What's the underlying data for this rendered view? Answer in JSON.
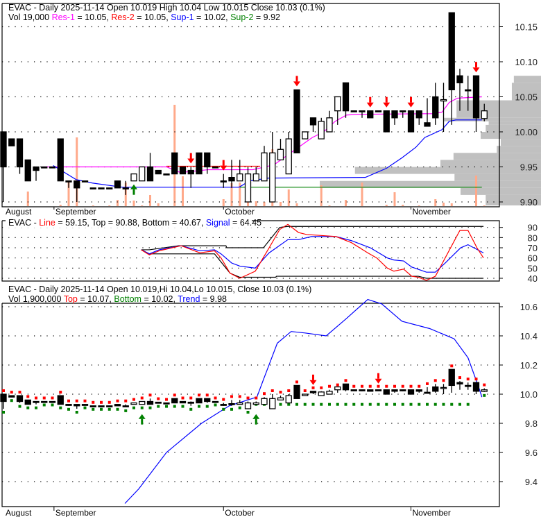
{
  "ticker": "EVAC",
  "main": {
    "header": {
      "line1": "EVAC - Daily 2025-11-14 Open 10.019  High 10.04  Low 10.015  Close 10.03 (0.1%)",
      "vol": "Vol 19,000 ",
      "res1_label": "Res-1",
      "res1_value": " = 10.05, ",
      "res2_label": "Res-2",
      "res2_value": " = 10.05, ",
      "sup1_label": "Sup-1",
      "sup1_value": " = 10.02, ",
      "sup2_label": "Sup-2",
      "sup2_value": " = 9.92"
    },
    "y_ticks": [
      "10.15",
      "10.10",
      "10.05",
      "10.00",
      "9.95",
      "9.90"
    ],
    "y_tick_values": [
      10.15,
      10.1,
      10.05,
      10.0,
      9.95,
      9.9
    ]
  },
  "stoch": {
    "header": {
      "prefix": "EVAC - ",
      "line_label": "Line",
      "mid": " = 59.15, Top = 90.88, Bottom = 40.67, ",
      "signal_label": "Signal",
      "signal_value": " = 64.45"
    },
    "y_ticks": [
      "90",
      "80",
      "70",
      "60",
      "50",
      "40"
    ],
    "y_tick_values": [
      90,
      80,
      70,
      60,
      50,
      40
    ]
  },
  "trend": {
    "header": {
      "line1": "EVAC - Daily 2025-11-14 Open 10.019,Hi 10.04,Lo 10.015, Close 10.03 (0.1%)",
      "vol": "Vol 1,900,000 ",
      "top_label": "Top",
      "top_value": " = 10.07, ",
      "bottom_label": "Bottom",
      "bottom_value": " = 10.02, ",
      "trend_label": "Trend",
      "trend_value": " = 9.98"
    },
    "y_ticks": [
      "10.6",
      "10.4",
      "10.2",
      "10.0",
      "9.8",
      "9.6",
      "9.4"
    ],
    "y_tick_values": [
      10.6,
      10.4,
      10.2,
      10.0,
      9.8,
      9.6,
      9.4
    ]
  },
  "months": [
    {
      "label": "August",
      "bar": 0
    },
    {
      "label": "September",
      "bar": 6.2
    },
    {
      "label": "October",
      "bar": 27
    },
    {
      "label": "November",
      "bar": 50
    }
  ],
  "colors": {
    "res1": "#ff00ff",
    "res2": "#ff0000",
    "sup1": "#0000ff",
    "sup2": "#008000",
    "volume": "#ffa98a",
    "profile": "#c0c0c0",
    "up_arrow": "#008000",
    "down_arrow": "#ff0000"
  },
  "chart_data": [
    {
      "type": "candlestick",
      "title": "EVAC - Daily",
      "ylim": [
        9.895,
        10.185
      ],
      "ohlc": [
        [
          10.0,
          10.0,
          9.9,
          9.95
        ],
        [
          9.99,
          9.99,
          9.98,
          9.98
        ],
        [
          9.99,
          9.99,
          9.94,
          9.95
        ],
        [
          9.96,
          9.96,
          9.93,
          9.93
        ],
        [
          9.95,
          9.95,
          9.93,
          9.945
        ],
        [
          9.95,
          9.95,
          9.95,
          9.95
        ],
        [
          9.95,
          9.95,
          9.95,
          9.95
        ],
        [
          9.99,
          9.99,
          9.93,
          9.93
        ],
        [
          9.93,
          9.93,
          9.92,
          9.93
        ],
        [
          9.93,
          9.93,
          9.9,
          9.92
        ],
        [
          9.93,
          9.93,
          9.93,
          9.93
        ],
        [
          9.92,
          9.92,
          9.92,
          9.92
        ],
        [
          9.92,
          9.92,
          9.92,
          9.92
        ],
        [
          9.92,
          9.92,
          9.92,
          9.92
        ],
        [
          9.93,
          9.93,
          9.92,
          9.92
        ],
        [
          9.92,
          9.93,
          9.91,
          9.92
        ],
        [
          9.93,
          9.94,
          9.93,
          9.94
        ],
        [
          9.93,
          9.95,
          9.93,
          9.95
        ],
        [
          9.95,
          9.97,
          9.93,
          9.93
        ],
        [
          9.945,
          9.945,
          9.94,
          9.94
        ],
        [
          9.94,
          9.94,
          9.94,
          9.94
        ],
        [
          9.97,
          9.97,
          9.94,
          9.94
        ],
        [
          9.95,
          9.95,
          9.94,
          9.94
        ],
        [
          9.945,
          9.95,
          9.92,
          9.94
        ],
        [
          9.97,
          9.97,
          9.94,
          9.94
        ],
        [
          9.97,
          9.97,
          9.94,
          9.95
        ],
        [
          9.95,
          9.95,
          9.95,
          9.95
        ],
        [
          9.93,
          9.94,
          9.92,
          9.93
        ],
        [
          9.935,
          9.96,
          9.92,
          9.93
        ],
        [
          9.93,
          9.96,
          9.93,
          9.94
        ],
        [
          9.9,
          9.95,
          9.9,
          9.94
        ],
        [
          9.93,
          9.95,
          9.93,
          9.94
        ],
        [
          9.93,
          9.98,
          9.93,
          9.97
        ],
        [
          9.9,
          10.0,
          9.9,
          9.97
        ],
        [
          9.96,
          9.99,
          9.96,
          9.975
        ],
        [
          9.94,
          10.0,
          9.94,
          9.99
        ],
        [
          10.06,
          10.06,
          9.97,
          9.97
        ],
        [
          9.99,
          10.0,
          9.99,
          10.0
        ],
        [
          10.02,
          10.02,
          10.0,
          10.01
        ],
        [
          9.99,
          10.02,
          9.99,
          10.015
        ],
        [
          10.0,
          10.03,
          10.0,
          10.02
        ],
        [
          10.03,
          10.04,
          10.01,
          10.05
        ],
        [
          10.07,
          10.07,
          10.02,
          10.03
        ],
        [
          10.03,
          10.03,
          10.03,
          10.03
        ],
        [
          10.03,
          10.03,
          10.02,
          10.03
        ],
        [
          10.03,
          10.03,
          10.02,
          10.02
        ],
        [
          10.03,
          10.03,
          10.03,
          10.03
        ],
        [
          10.03,
          10.03,
          10.0,
          10.0
        ],
        [
          10.03,
          10.03,
          10.01,
          10.02
        ],
        [
          10.03,
          10.03,
          10.02,
          10.03
        ],
        [
          10.03,
          10.03,
          10.0,
          10.0
        ],
        [
          10.03,
          10.03,
          10.01,
          10.02
        ],
        [
          10.013,
          10.048,
          10.008,
          10.008
        ],
        [
          10.05,
          10.07,
          10.01,
          10.02
        ],
        [
          10.044,
          10.07,
          10.0,
          10.046
        ],
        [
          10.17,
          10.17,
          10.01,
          10.06
        ],
        [
          10.08,
          10.09,
          10.03,
          10.07
        ],
        [
          10.06,
          10.08,
          10.03,
          10.06
        ],
        [
          10.08,
          10.08,
          10.0,
          10.02
        ],
        [
          10.019,
          10.04,
          10.015,
          10.03
        ]
      ],
      "volume_relative": [
        0,
        0,
        0,
        21,
        0,
        0,
        0,
        2,
        37,
        99,
        0,
        1,
        0,
        1,
        9,
        34,
        8,
        1,
        16,
        4,
        0,
        146,
        43,
        0,
        0,
        0,
        0,
        10,
        33,
        34,
        10,
        7,
        6,
        82,
        6,
        24,
        4,
        0,
        0,
        30,
        1,
        0,
        9,
        0,
        34,
        0,
        0,
        2,
        20,
        2,
        0,
        1,
        0,
        10,
        5,
        4,
        0,
        0,
        44,
        1
      ],
      "res1_line": [
        [
          4.9,
          9.95
        ],
        [
          20,
          9.95
        ],
        [
          21.7,
          9.942
        ],
        [
          25.1,
          9.946
        ],
        [
          30.6,
          9.946
        ],
        [
          33.2,
          9.953
        ],
        [
          36.2,
          9.978
        ],
        [
          37.9,
          9.992
        ],
        [
          39.3,
          10.0
        ],
        [
          40.7,
          10.015
        ],
        [
          42.1,
          10.024
        ],
        [
          43.6,
          10.025
        ],
        [
          52.8,
          10.026
        ],
        [
          53.8,
          10.028
        ],
        [
          54.7,
          10.042
        ],
        [
          55.7,
          10.048
        ],
        [
          58.7,
          10.05
        ]
      ],
      "sup1_line": [
        [
          6.1,
          9.952
        ],
        [
          8.9,
          9.932
        ],
        [
          10.9,
          9.927
        ],
        [
          14.6,
          9.921
        ],
        [
          28.9,
          9.921
        ],
        [
          30.2,
          9.93
        ],
        [
          32.5,
          9.934
        ],
        [
          44.4,
          9.935
        ],
        [
          47,
          9.948
        ],
        [
          48.9,
          9.963
        ],
        [
          50.6,
          9.978
        ],
        [
          51.7,
          9.992
        ],
        [
          53.8,
          10.003
        ],
        [
          54.7,
          10.015
        ],
        [
          55.5,
          10.017
        ],
        [
          58.7,
          10.017
        ]
      ],
      "res2_line": [
        [
          20,
          9.951
        ],
        [
          31.5,
          9.951
        ]
      ],
      "sup2_line": [
        [
          29,
          9.921
        ],
        [
          58.7,
          9.921
        ]
      ],
      "sell_arrows": [
        23,
        27,
        36,
        45,
        47,
        50,
        58
      ],
      "buy_arrows": [
        16
      ],
      "volume_profile": [
        [
          10.07,
          10.08,
          0.27
        ],
        [
          10.045,
          10.07,
          0.29
        ],
        [
          10.02,
          10.045,
          0.84
        ],
        [
          10.015,
          10.02,
          0.97
        ],
        [
          10.01,
          10.015,
          0.52
        ],
        [
          10.0,
          10.01,
          0.55
        ],
        [
          9.99,
          10.0,
          0.6
        ],
        [
          9.98,
          9.99,
          0.4
        ],
        [
          9.97,
          9.98,
          0.44
        ],
        [
          9.96,
          9.97,
          0.87
        ],
        [
          9.95,
          9.96,
          1.0
        ],
        [
          9.94,
          9.95,
          1.85
        ],
        [
          9.93,
          9.94,
          0.86
        ],
        [
          9.92,
          9.93,
          2.2
        ],
        [
          9.91,
          9.92,
          0.8
        ],
        [
          9.895,
          9.91,
          0.55
        ]
      ]
    },
    {
      "type": "line",
      "title": "Stochastic",
      "ylim": [
        38,
        93
      ],
      "series": [
        {
          "name": "Line",
          "points": [
            [
              16.9,
              68
            ],
            [
              17.9,
              63
            ],
            [
              19.1,
              67
            ],
            [
              21.8,
              72
            ],
            [
              24.1,
              65
            ],
            [
              25.9,
              67
            ],
            [
              26.7,
              60
            ],
            [
              27.8,
              45
            ],
            [
              29.0,
              40
            ],
            [
              30.9,
              47
            ],
            [
              32.6,
              70
            ],
            [
              33.9,
              88
            ],
            [
              34.9,
              93
            ],
            [
              36.2,
              85
            ],
            [
              37.2,
              83
            ],
            [
              39.1,
              82
            ],
            [
              40.8,
              81
            ],
            [
              42.7,
              75
            ],
            [
              44.7,
              65
            ],
            [
              45.8,
              60
            ],
            [
              47.1,
              50
            ],
            [
              47.9,
              47
            ],
            [
              49.1,
              49
            ],
            [
              50.1,
              42
            ],
            [
              50.9,
              41
            ],
            [
              51.9,
              38
            ],
            [
              53.0,
              42
            ],
            [
              54.2,
              60
            ],
            [
              56.0,
              87
            ],
            [
              57.0,
              87
            ],
            [
              58.1,
              70
            ],
            [
              58.9,
              60
            ]
          ]
        },
        {
          "name": "Signal",
          "points": [
            [
              16.9,
              68
            ],
            [
              17.9,
              64
            ],
            [
              19.1,
              68
            ],
            [
              21.8,
              72
            ],
            [
              24.1,
              67
            ],
            [
              25.9,
              68
            ],
            [
              26.7,
              64
            ],
            [
              28.0,
              55
            ],
            [
              29.0,
              52
            ],
            [
              30.9,
              50
            ],
            [
              32.6,
              65
            ],
            [
              34.9,
              78
            ],
            [
              36.2,
              78
            ],
            [
              37.8,
              81
            ],
            [
              40.8,
              81
            ],
            [
              42.7,
              77
            ],
            [
              45.0,
              70
            ],
            [
              47.1,
              60
            ],
            [
              47.9,
              58
            ],
            [
              49.1,
              57
            ],
            [
              50.1,
              51
            ],
            [
              51.9,
              46
            ],
            [
              53.0,
              46
            ],
            [
              54.2,
              55
            ],
            [
              56.1,
              70
            ],
            [
              57.0,
              73
            ],
            [
              58.9,
              65
            ]
          ]
        },
        {
          "name": "Top",
          "points": [
            [
              16.9,
              68
            ],
            [
              17.9,
              68
            ],
            [
              21.5,
              72
            ],
            [
              27.3,
              72
            ],
            [
              27.4,
              70
            ],
            [
              31.9,
              70
            ],
            [
              33.9,
              90
            ],
            [
              34.9,
              91
            ],
            [
              58.9,
              91
            ]
          ]
        },
        {
          "name": "Bottom",
          "points": [
            [
              16.9,
              68
            ],
            [
              17.9,
              64
            ],
            [
              25.9,
              64
            ],
            [
              27.8,
              45
            ],
            [
              29.0,
              41
            ],
            [
              33.4,
              41
            ],
            [
              33.5,
              42
            ],
            [
              50.9,
              42
            ],
            [
              51.9,
              40
            ],
            [
              58.9,
              40
            ]
          ]
        }
      ]
    },
    {
      "type": "candlestick",
      "title": "Trend",
      "ylim": [
        9.2,
        10.75
      ],
      "trend_line": [
        [
          14.9,
          9.25
        ],
        [
          16.6,
          9.35
        ],
        [
          20,
          9.6
        ],
        [
          24.3,
          9.8
        ],
        [
          27.7,
          9.92
        ],
        [
          31.1,
          9.98
        ],
        [
          31.9,
          10.1
        ],
        [
          33.6,
          10.35
        ],
        [
          35.3,
          10.43
        ],
        [
          37,
          10.42
        ],
        [
          39.6,
          10.4
        ],
        [
          42.1,
          10.52
        ],
        [
          44.7,
          10.65
        ],
        [
          46.4,
          10.62
        ],
        [
          48.9,
          10.5
        ],
        [
          52.3,
          10.45
        ],
        [
          55.3,
          10.38
        ],
        [
          57,
          10.25
        ],
        [
          58.3,
          10.05
        ],
        [
          58.7,
          9.98
        ]
      ],
      "bottom_line": {
        "value": 9.93,
        "from_bar": 31,
        "to_bar": 57
      },
      "buy_arrows": [
        17,
        31
      ],
      "sell_arrows": [
        38,
        46
      ]
    }
  ]
}
